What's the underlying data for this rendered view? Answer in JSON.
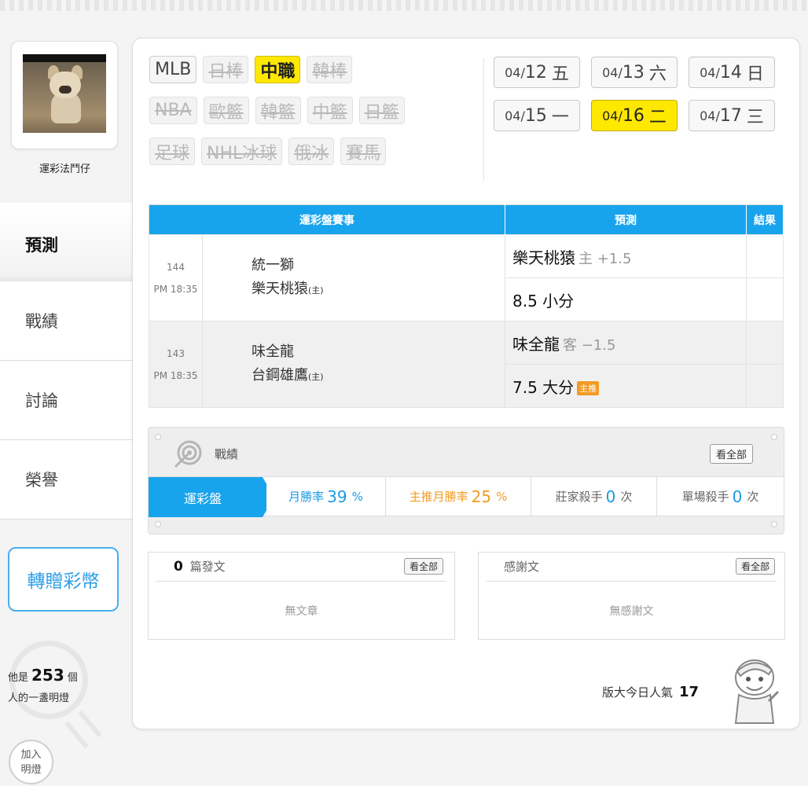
{
  "sidebar": {
    "username": "運彩法鬥仔",
    "nav": [
      "預測",
      "戰績",
      "討論",
      "榮譽"
    ],
    "gift_button": "轉贈彩幣",
    "lamp": {
      "prefix": "他是",
      "count": "253",
      "suffix": "個",
      "line2": "人的一盞明燈"
    },
    "join_button": {
      "line1": "加入",
      "line2": "明燈"
    }
  },
  "leagues": {
    "row1": [
      "MLB",
      "日棒",
      "中職",
      "韓棒"
    ],
    "row2": [
      "NBA",
      "歐籃",
      "韓籃",
      "中籃",
      "日籃"
    ],
    "row3": [
      "足球",
      "NHL冰球",
      "俄冰",
      "賽馬"
    ],
    "active": "中職"
  },
  "dates": [
    {
      "md": "04/",
      "d": "12",
      "w": "五"
    },
    {
      "md": "04/",
      "d": "13",
      "w": "六"
    },
    {
      "md": "04/",
      "d": "14",
      "w": "日"
    },
    {
      "md": "04/",
      "d": "15",
      "w": "一"
    },
    {
      "md": "04/",
      "d": "16",
      "w": "二"
    },
    {
      "md": "04/",
      "d": "17",
      "w": "三"
    }
  ],
  "table": {
    "headers": {
      "game": "運彩盤賽事",
      "pred": "預測",
      "result": "結果"
    },
    "games": [
      {
        "no": "144",
        "time": "PM 18:35",
        "away": "統一獅",
        "home": "樂天桃猿",
        "home_tag": "(主)",
        "pred1": {
          "main": "樂天桃猿",
          "sub": "主 +1.5"
        },
        "pred2": {
          "main": "8.5 小分"
        }
      },
      {
        "no": "143",
        "time": "PM 18:35",
        "away": "味全龍",
        "home": "台鋼雄鷹",
        "home_tag": "(主)",
        "pred1": {
          "main": "味全龍",
          "sub": "客 −1.5"
        },
        "pred2": {
          "main": "7.5 大分",
          "badge": "主推"
        }
      }
    ]
  },
  "record": {
    "title": "戰績",
    "see_all": "看全部",
    "tab": "運彩盤",
    "monthly": {
      "label": "月勝率",
      "value": "39",
      "unit": "%"
    },
    "main_monthly": {
      "label": "主推月勝率",
      "value": "25",
      "unit": "%"
    },
    "house_killer": {
      "label": "莊家殺手",
      "value": "0",
      "unit": "次"
    },
    "single_killer": {
      "label": "單場殺手",
      "value": "0",
      "unit": "次"
    }
  },
  "posts": {
    "count": "0",
    "label": "篇發文",
    "see_all": "看全部",
    "empty": "無文章"
  },
  "thanks": {
    "label": "感謝文",
    "see_all": "看全部",
    "empty": "無感謝文"
  },
  "popularity": {
    "label": "版大今日人氣",
    "value": "17"
  },
  "colors": {
    "accent": "#18a4ec",
    "highlight": "#ffe800",
    "orange": "#f39a23"
  }
}
